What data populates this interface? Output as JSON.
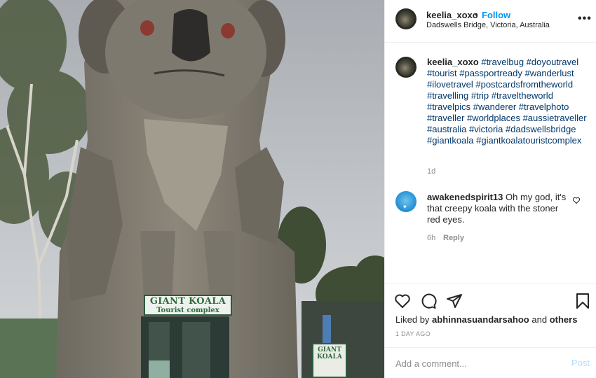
{
  "photo": {
    "sign_main_title": "GIANT KOALA",
    "sign_main_subtitle": "Tourist complex",
    "sign_small_title": "GIANT KOALA"
  },
  "header": {
    "username": "keelia_xoxo",
    "dot": "•",
    "follow_label": "Follow",
    "location": "Dadswells Bridge, Victoria, Australia",
    "more_icon": "more-icon"
  },
  "caption": {
    "username": "keelia_xoxo",
    "hashtags": "#travelbug #doyoutravel #tourist #passportready #wanderlust #ilovetravel #postcardsfromtheworld #travelling #trip #traveltheworld #travelpics #wanderer #travelphoto #traveller #worldplaces #aussietraveller #australia #victoria #dadswellsbridge #giantkoala #giantkoalatouristcomplex",
    "time": "1d"
  },
  "comment": {
    "username": "awakenedspirit13",
    "text": "Oh my god, it's that creepy koala with the stoner red eyes.",
    "time": "6h",
    "reply_label": "Reply",
    "like_icon": "heart-icon"
  },
  "actions": {
    "icons": [
      "like-icon",
      "comment-icon",
      "share-icon",
      "save-icon"
    ]
  },
  "likes": {
    "prefix": "Liked by",
    "user": "abhinnasuandarsahoo",
    "middle": "and",
    "suffix": "others"
  },
  "post_date": "1 DAY AGO",
  "add_comment": {
    "placeholder": "Add a comment...",
    "post_label": "Post"
  },
  "colors": {
    "link_blue": "#0095f6",
    "hashtag": "#00376b",
    "muted": "#8e8e8e",
    "post_disabled": "#b2dffc"
  }
}
